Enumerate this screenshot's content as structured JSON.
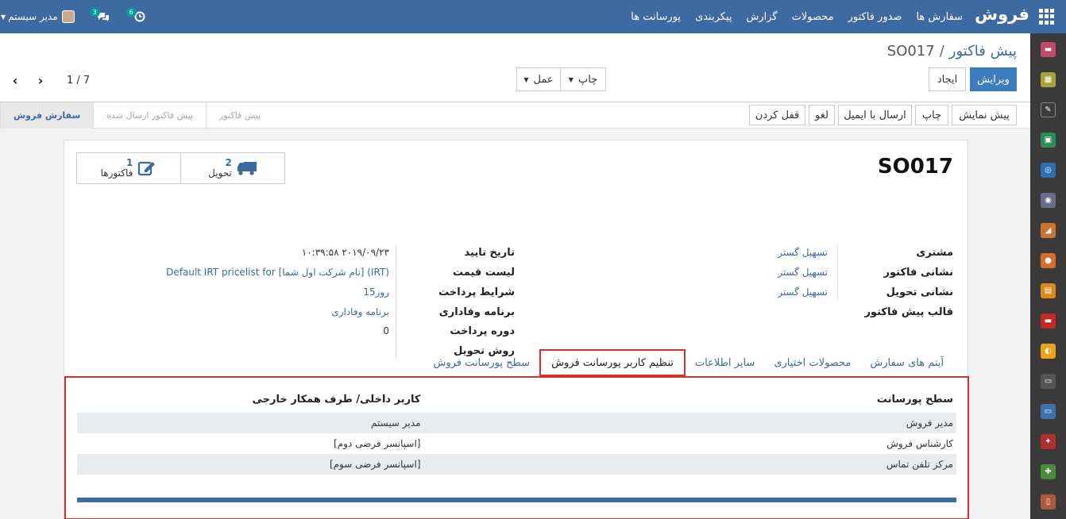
{
  "app": {
    "brand": "فروش",
    "menu": [
      "سفارش ها",
      "صدور فاکتور",
      "محصولات",
      "گزارش",
      "پیکربندی",
      "پورسانت ها"
    ]
  },
  "user": {
    "name": "مدیر سیستم",
    "messages_badge": "3",
    "activities_badge": "6"
  },
  "breadcrumb": {
    "parent": "پیش فاکتور",
    "separator": "/",
    "current": "SO017"
  },
  "toolbar": {
    "edit_label": "ویرایش",
    "create_label": "ایجاد",
    "print_label": "چاپ",
    "action_label": "عمل"
  },
  "pager": {
    "text": "1 / 7"
  },
  "statusbar": {
    "buttons": [
      "پیش نمایش",
      "چاپ",
      "ارسال با ایمیل",
      "لغو",
      "قفل کردن"
    ],
    "stages": [
      "سفارش فروش",
      "پیش فاکتور ارسال شده",
      "پیش فاکتور"
    ],
    "active_stage": "سفارش فروش"
  },
  "sheet": {
    "title": "SO017",
    "smart_buttons": [
      {
        "count": "2",
        "label": "تحویل",
        "icon": "truck-icon"
      },
      {
        "count": "1",
        "label": "فاکتورها",
        "icon": "edit-icon"
      }
    ],
    "left_fields": {
      "customer_label": "مشتری",
      "customer_value": "تسهیل گستر",
      "invoice_address_label": "نشانی فاکتور",
      "invoice_address_value": "تسهیل گستر",
      "delivery_address_label": "نشانی تحویل",
      "delivery_address_value": "تسهیل گستر",
      "template_label": "قالب پیش فاکتور"
    },
    "right_fields": {
      "confirm_date_label": "تاریخ تایید",
      "confirm_date_value": "۱۰:۳۹:۵۸ ۲۰۱۹/۰۹/۲۳",
      "pricelist_label": "لیست قیمت",
      "pricelist_value": "Default IRT pricelist for [نام شرکت اول شما] (IRT)",
      "payment_terms_label": "شرایط پرداخت",
      "payment_terms_value": "15روز",
      "loyalty_label": "برنامه وفاداری",
      "loyalty_value": "برنامه وفاداری",
      "payment_period_label": "دوره پرداخت",
      "payment_period_value": "0",
      "delivery_method_label": "روش تحویل"
    },
    "tabs": [
      "آیتم های سفارش",
      "محصولات اختیاری",
      "سایر اطلاعات",
      "تنظیم کاربر پورسانت فروش",
      "سطح پورسانت فروش"
    ],
    "active_tab": "تنظیم کاربر پورسانت فروش",
    "commission_table": {
      "headers": [
        "سطح پورسانت",
        "کاربر داخلی/ طرف همکار خارجی"
      ],
      "rows": [
        [
          "مدیر فروش",
          "مدیر سیستم"
        ],
        [
          "کارشناس فروش",
          "[اسپانسر فرضی دوم]"
        ],
        [
          "مرکز تلفن تماس",
          "[اسپانسر فرضی سوم]"
        ]
      ]
    }
  },
  "colors": {
    "navbar": "#3d6aa0",
    "primary": "#3d7cbd",
    "highlight": "#d9302d",
    "app_strip": "#3a3a3a"
  }
}
